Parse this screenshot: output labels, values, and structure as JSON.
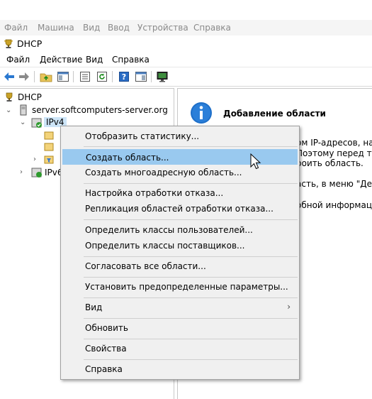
{
  "vm_menu": [
    "Файл",
    "Машина",
    "Вид",
    "Ввод",
    "Устройства",
    "Справка"
  ],
  "window": {
    "title": "DHCP"
  },
  "menu": [
    "Файл",
    "Действие",
    "Вид",
    "Справка"
  ],
  "tree": {
    "root": "DHCP",
    "server": "server.softcomputers-server.org",
    "ipv4": "IPv4",
    "ipv6": "IPv6"
  },
  "detail": {
    "title": "Добавление области",
    "lines": [
      "ом IP-адресов, назн",
      "Поэтому перед тем",
      "роить область.",
      "асть, в меню \"Дейс",
      "обной информации"
    ]
  },
  "context_menu": {
    "items": [
      "Отобразить статистику...",
      "Создать область...",
      "Создать многоадресную область...",
      "Настройка отработки отказа...",
      "Репликация областей отработки отказа...",
      "Определить классы пользователей...",
      "Определить классы поставщиков...",
      "Согласовать все области...",
      "Установить предопределенные параметры...",
      "Вид",
      "Обновить",
      "Свойства",
      "Справка"
    ],
    "highlighted_index": 1
  },
  "colors": {
    "highlight": "#99c9ef",
    "menu_bg": "#f0f0f0",
    "accent": "#1e6fc9"
  },
  "icons": [
    "trophy-icon",
    "back-arrow-icon",
    "forward-arrow-icon",
    "folder-up-icon",
    "tree-view-icon",
    "list-icon",
    "refresh-icon",
    "help-icon",
    "properties-icon",
    "monitor-icon",
    "info-icon",
    "server-icon",
    "ipv4-icon",
    "chevron-right-icon",
    "mouse-cursor-icon"
  ]
}
